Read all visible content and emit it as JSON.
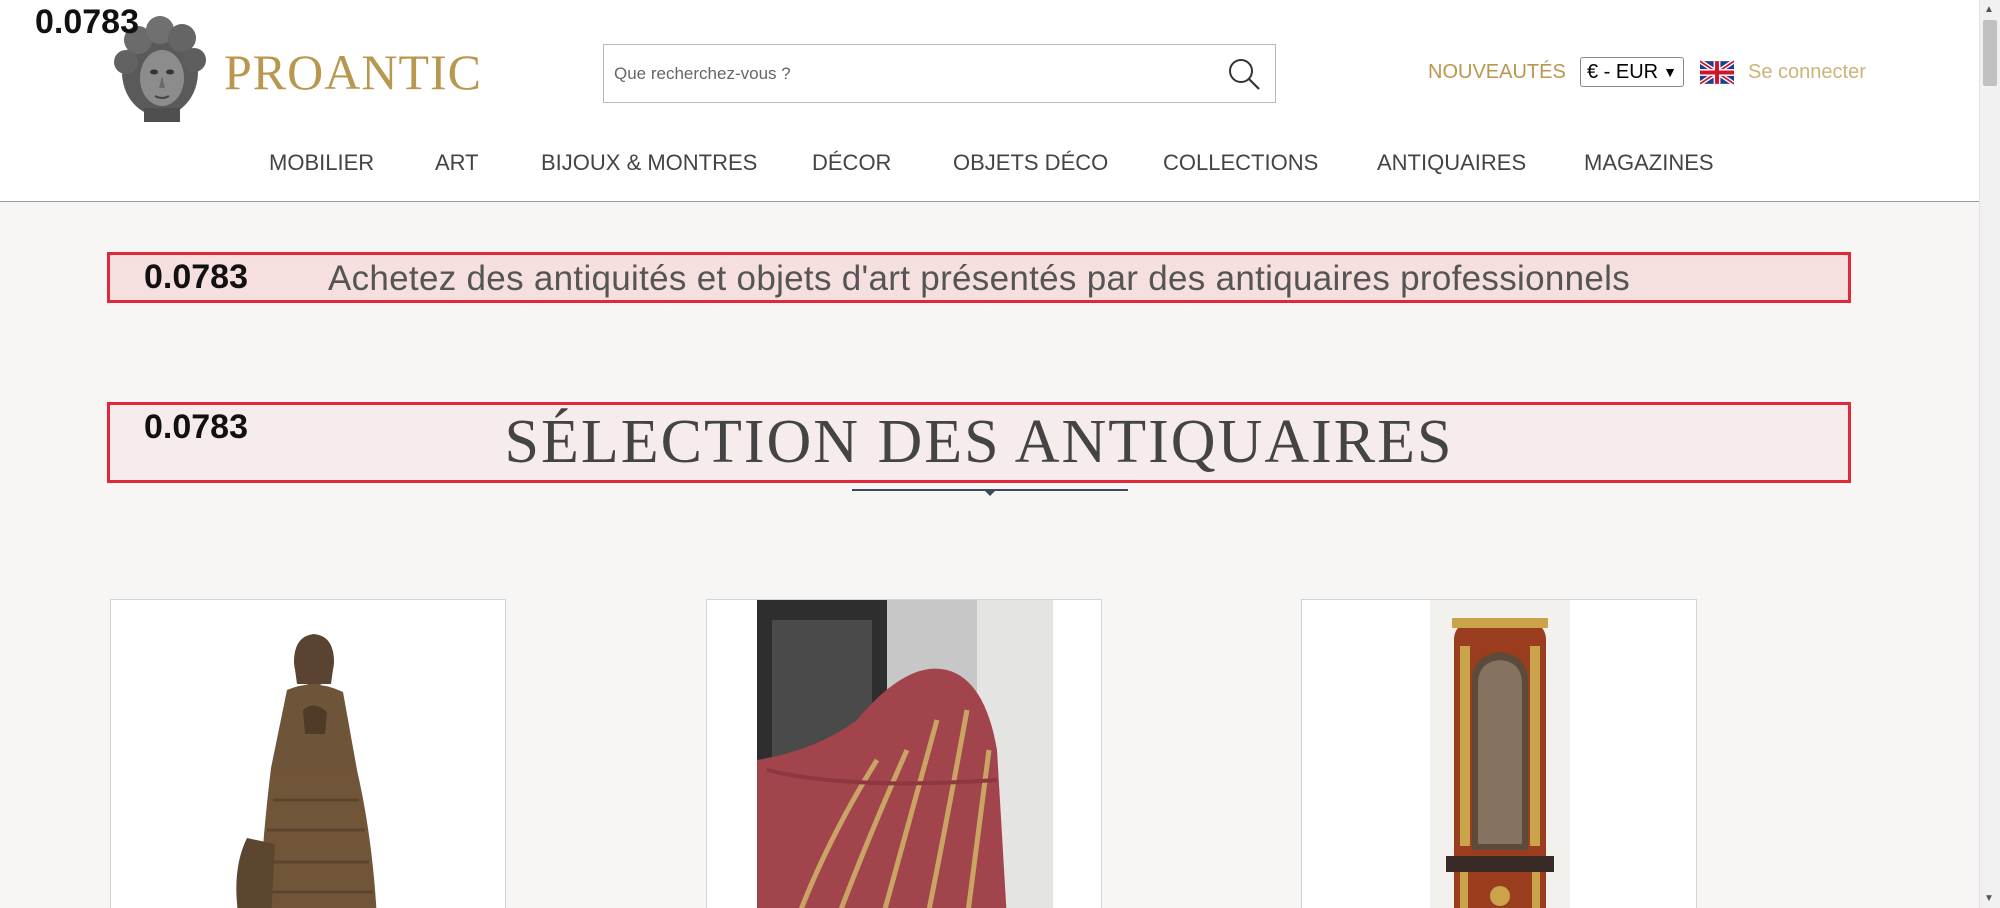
{
  "overlay_value": "0.0783",
  "brand": {
    "name": "PROANTIC"
  },
  "search": {
    "placeholder": "Que recherchez-vous ?"
  },
  "header_links": {
    "new": "NOUVEAUTÉS",
    "currency": "€ - EUR",
    "login": "Se connecter"
  },
  "nav": [
    "MOBILIER",
    "ART",
    "BIJOUX & MONTRES",
    "DÉCOR",
    "OBJETS DÉCO",
    "COLLECTIONS",
    "ANTIQUAIRES",
    "MAGAZINES"
  ],
  "banner": {
    "text": "Achetez des antiquités et objets d'art présentés par des antiquaires professionnels"
  },
  "section": {
    "title": "SÉLECTION DES ANTIQUAIRES"
  },
  "colors": {
    "brand_gold": "#b9974f",
    "highlight_border": "#e0283a",
    "background": "#f7f6f4"
  },
  "icons": [
    "search-icon",
    "uk-flag-icon",
    "chevron-down-icon"
  ]
}
